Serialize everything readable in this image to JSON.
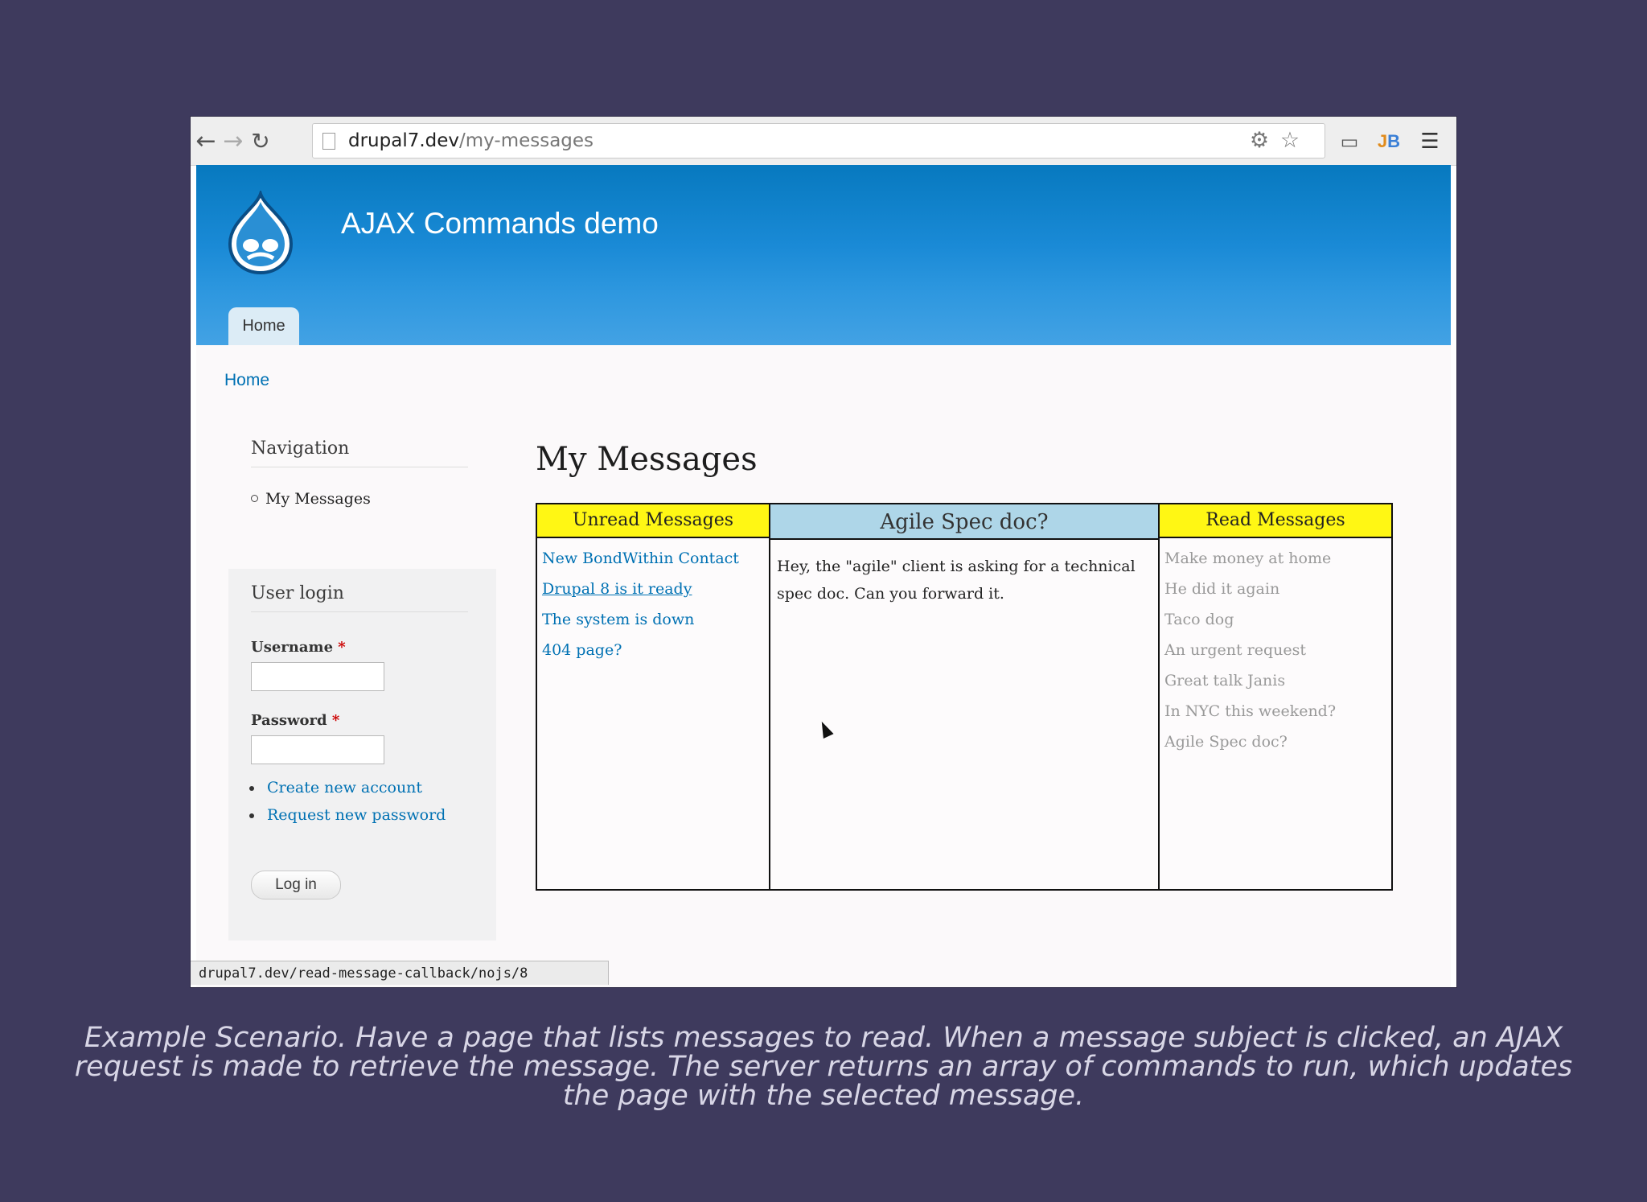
{
  "browser": {
    "url_domain": "drupal7.dev",
    "url_path": "/my-messages",
    "status_url": "drupal7.dev/read-message-callback/nojs/8",
    "icons": [
      "back-icon",
      "forward-icon",
      "reload-icon",
      "page-icon",
      "settings-icon",
      "star-icon",
      "cast-icon",
      "jb-extension-icon",
      "menu-icon"
    ]
  },
  "site": {
    "name": "AJAX Commands demo",
    "tab_home": "Home",
    "breadcrumb": "Home"
  },
  "sidebar": {
    "navigation_title": "Navigation",
    "nav_items": [
      {
        "label": "My Messages"
      }
    ],
    "login": {
      "title": "User login",
      "username_label": "Username",
      "password_label": "Password",
      "required_mark": "*",
      "links": [
        {
          "label": "Create new account"
        },
        {
          "label": "Request new password"
        }
      ],
      "button": "Log in"
    }
  },
  "main": {
    "title": "My Messages",
    "unread_header": "Unread Messages",
    "unread": [
      {
        "subject": "New BondWithin Contact"
      },
      {
        "subject": "Drupal 8 is it ready"
      },
      {
        "subject": "The system is down"
      },
      {
        "subject": "404 page?"
      }
    ],
    "selected_subject": "Agile Spec doc?",
    "selected_body": "Hey, the \"agile\" client is asking for a technical spec doc. Can you forward it.",
    "read_header": "Read Messages",
    "read": [
      {
        "subject": "Make money at home"
      },
      {
        "subject": "He did it again"
      },
      {
        "subject": "Taco dog"
      },
      {
        "subject": "An urgent request"
      },
      {
        "subject": "Great talk Janis"
      },
      {
        "subject": "In NYC this weekend?"
      },
      {
        "subject": "Agile Spec doc?"
      }
    ]
  },
  "caption": "Example Scenario. Have a page that lists messages to read. When a message subject is clicked, an AJAX request is made to retrieve the message. The server returns an array of commands to run, which updates the page with the selected message.",
  "colors": {
    "background": "#3e3a5d",
    "header_blue": "#0779bf",
    "link_blue": "#0071b3",
    "column_yellow": "#fff714",
    "column_lightblue": "#aed6e8"
  }
}
